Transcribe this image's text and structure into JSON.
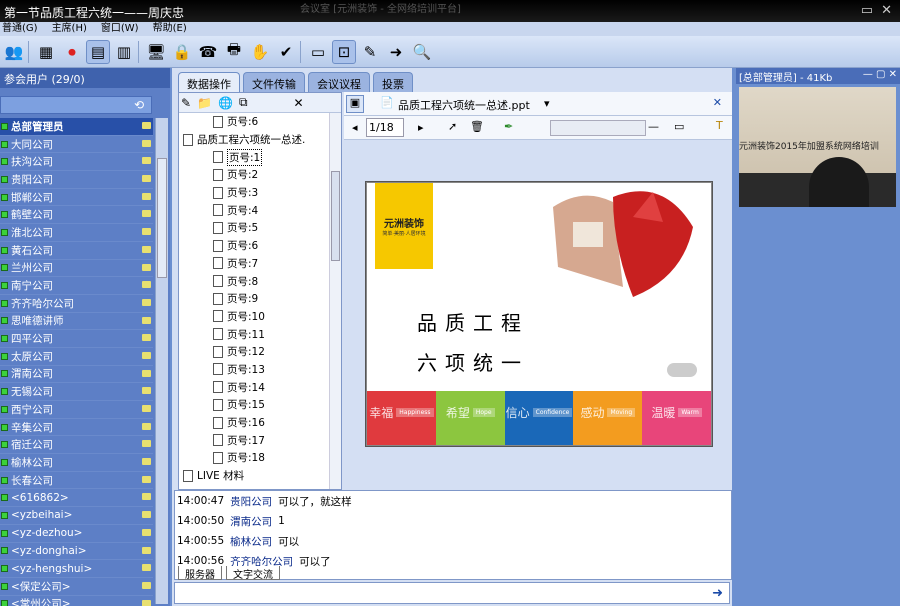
{
  "window": {
    "title": "第一节品质工程六统一——周庆忠",
    "faded": "会议室  [元洲装饰 - 全网络培训平台]"
  },
  "menu": [
    "普通(G)",
    "主席(H)",
    "窗口(W)",
    "帮助(E)"
  ],
  "toolbar_icons": [
    "users-icon",
    "grid-icon",
    "stop-icon",
    "layout-icon",
    "layout2-icon",
    "screen-icon",
    "lock-icon",
    "phone-icon",
    "print-icon",
    "hand-icon",
    "check-user-icon",
    "card-icon",
    "share-screen-icon",
    "whiteboard-icon",
    "export-icon",
    "search-icon"
  ],
  "left": {
    "header": "参会用户 (29/0)",
    "users": [
      "总部管理员",
      "大同公司",
      "扶沟公司",
      "贵阳公司",
      "邯郸公司",
      "鹤壁公司",
      "淮北公司",
      "黄石公司",
      "兰州公司",
      "南宁公司",
      "齐齐哈尔公司",
      "思唯德讲师",
      "四平公司",
      "太原公司",
      "渭南公司",
      "无锡公司",
      "西宁公司",
      "辛集公司",
      "宿迁公司",
      "榆林公司",
      "长春公司",
      "<616862>",
      "<yzbeihai>",
      "<yz-dezhou>",
      "<yz-donghai>",
      "<yz-hengshui>",
      "<保定公司>",
      "<常州公司>"
    ],
    "selected": 0
  },
  "tabs": [
    "数据操作",
    "文件传输",
    "会议议程",
    "投票"
  ],
  "tree": {
    "top_item": "页号:6",
    "parent": "品质工程六项统一总述.",
    "pages": [
      "页号:1",
      "页号:2",
      "页号:3",
      "页号:4",
      "页号:5",
      "页号:6",
      "页号:7",
      "页号:8",
      "页号:9",
      "页号:10",
      "页号:11",
      "页号:12",
      "页号:13",
      "页号:14",
      "页号:15",
      "页号:16",
      "页号:17",
      "页号:18"
    ],
    "next": "LIVE 材料"
  },
  "doc": {
    "filename": "品质工程六项统一总述.ppt",
    "page": "1/18"
  },
  "slide": {
    "logo": "元洲装饰",
    "logo_sub": "简单·美丽·人居环境",
    "line1": "品质工程",
    "line2": "六项统一",
    "strip": [
      {
        "cn": "幸福",
        "en": "Happiness",
        "color": "#e03a3e"
      },
      {
        "cn": "希望",
        "en": "Hope",
        "color": "#8cc63f"
      },
      {
        "cn": "信心",
        "en": "Confidence",
        "color": "#1a68b8"
      },
      {
        "cn": "感动",
        "en": "Moving",
        "color": "#f39c1f"
      },
      {
        "cn": "温暖",
        "en": "Warm",
        "color": "#e8457a"
      }
    ]
  },
  "chat": [
    {
      "time": "14:00:47",
      "name": "贵阳公司",
      "msg": "可以了，就这样"
    },
    {
      "time": "14:00:50",
      "name": "渭南公司",
      "msg": "1"
    },
    {
      "time": "14:00:55",
      "name": "榆林公司",
      "msg": "可以"
    },
    {
      "time": "14:00:56",
      "name": "齐齐哈尔公司",
      "msg": "可以了"
    }
  ],
  "chattabs": [
    "服务器",
    "文字交流"
  ],
  "right": {
    "header": "[总部管理员] - 41Kb",
    "video_text": "元洲装饰2015年加盟系统网络培训"
  }
}
